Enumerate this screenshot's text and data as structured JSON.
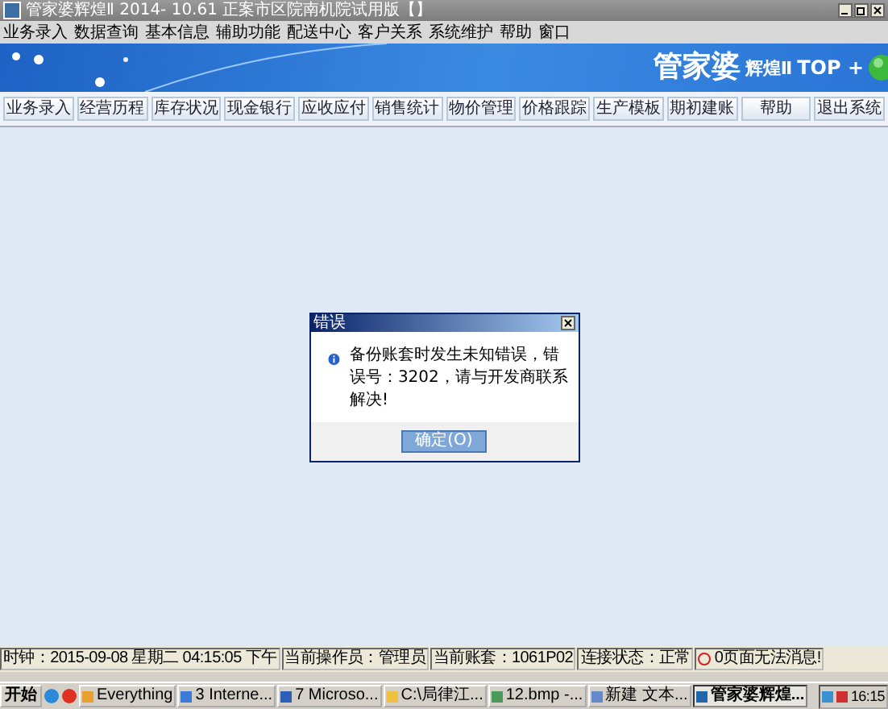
{
  "window": {
    "title": "管家婆辉煌Ⅱ 2014- 10.61 正案市区院南机院试用版【】"
  },
  "menu": [
    "业务录入",
    "数据查询",
    "基本信息",
    "辅助功能",
    "配送中心",
    "客户关系",
    "系统维护",
    "帮助",
    "窗口"
  ],
  "banner": {
    "logo": "管家婆",
    "product": "辉煌Ⅱ",
    "edition": "TOP +"
  },
  "toolbar": [
    "业务录入",
    "经营历程",
    "库存状况",
    "现金银行",
    "应收应付",
    "销售统计",
    "物价管理",
    "价格跟踪",
    "生产模板",
    "期初建账",
    "帮助",
    "退出系统"
  ],
  "dialog": {
    "title": "错误",
    "message": "备份账套时发生未知错误，错误号：3202，请与开发商联系解决!",
    "button": "确定(O)"
  },
  "status_bar": [
    {
      "text": "时钟：2015-09-08 星期二 04:15:05 下午",
      "kind": "plain"
    },
    {
      "text": "当前操作员：管理员",
      "kind": "plain"
    },
    {
      "text": "当前账套：1061P02",
      "kind": "plain"
    },
    {
      "text": "连接状态：正常",
      "kind": "plain"
    },
    {
      "text": "0页面无法消息!",
      "kind": "alert"
    }
  ],
  "taskbar": {
    "start": "开始",
    "tasks": [
      {
        "label": "Everything",
        "selected": false
      },
      {
        "label": "3 Interne...",
        "selected": false
      },
      {
        "label": "7 Microso...",
        "selected": false
      },
      {
        "label": "C:\\局律江...",
        "selected": false
      },
      {
        "label": "12.bmp -...",
        "selected": false
      },
      {
        "label": "新建 文本...",
        "selected": false
      },
      {
        "label": "管家婆辉煌...",
        "selected": true
      }
    ],
    "clock": "16:15"
  }
}
